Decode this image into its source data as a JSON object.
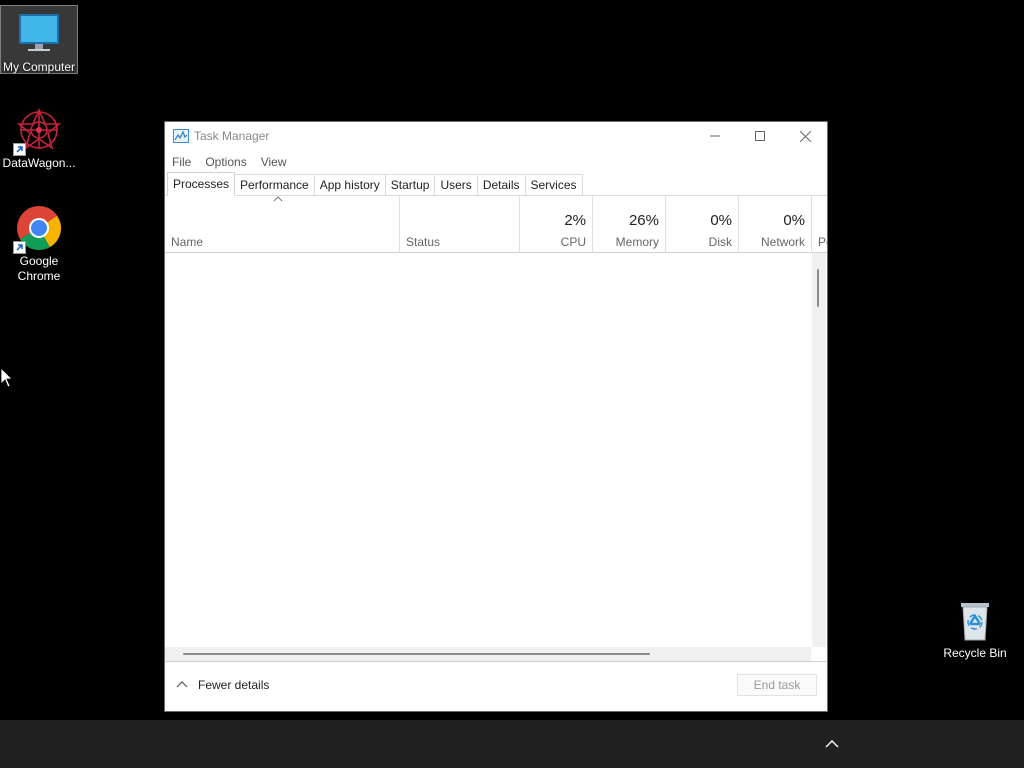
{
  "desktop": {
    "icons": [
      {
        "label": "My Computer",
        "icon": "monitor-icon"
      },
      {
        "label": "DataWagon...",
        "icon": "datawagon-icon"
      },
      {
        "label": "Google Chrome",
        "icon": "chrome-icon"
      },
      {
        "label": "Recycle Bin",
        "icon": "recycle-bin-icon"
      }
    ]
  },
  "window": {
    "title": "Task Manager",
    "controls": [
      "minimize-icon",
      "maximize-icon",
      "close-icon"
    ],
    "menu": [
      "File",
      "Options",
      "View"
    ],
    "tabs": [
      "Processes",
      "Performance",
      "App history",
      "Startup",
      "Users",
      "Details",
      "Services"
    ],
    "active_tab": "Processes",
    "columns": {
      "name": {
        "label": "Name"
      },
      "status": {
        "label": "Status"
      },
      "cpu": {
        "label": "CPU",
        "value": "2%"
      },
      "memory": {
        "label": "Memory",
        "value": "26%"
      },
      "disk": {
        "label": "Disk",
        "value": "0%"
      },
      "network": {
        "label": "Network",
        "value": "0%"
      },
      "power": {
        "label": "Po"
      }
    },
    "footer": {
      "fewer_details": "Fewer details",
      "end_task": "End task"
    }
  },
  "colors": {
    "desktop_bg": "#000000",
    "taskbar_bg": "#202020",
    "window_bg": "#ffffff"
  }
}
